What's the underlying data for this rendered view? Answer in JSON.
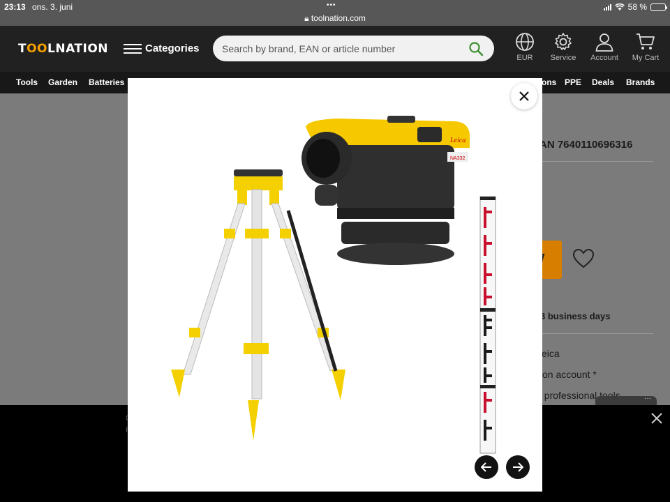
{
  "status": {
    "time": "23:13",
    "date": "ons. 3. juni",
    "url": "toolnation.com",
    "battery": "58 %",
    "battery_level": 0.58
  },
  "header": {
    "logo_pre": "T",
    "logo_o": "OO",
    "logo_post": "LNATION",
    "categories_label": "Categories",
    "search_placeholder": "Search by brand, EAN or article number",
    "currency_label": "EUR",
    "service_label": "Service",
    "account_label": "Account",
    "cart_label": "My Cart"
  },
  "nav": {
    "items": [
      "Tools",
      "Garden",
      "Batteries"
    ],
    "right_items": [
      "ons",
      "PPE",
      "Deals",
      "Brands"
    ]
  },
  "page": {
    "ean": "AN 7640110696316",
    "delivery": "3 business days",
    "brand_fragment": "eica",
    "account_fragment": "on account *",
    "pro_fragment": "f professional tools"
  },
  "banner": {
    "line1": "C",
    "line2": "F"
  },
  "modal": {
    "image_label": "Leica",
    "model_label": "NA332"
  },
  "colors": {
    "accent": "#f5a000",
    "cart": "#d77e00",
    "yellow": "#f5d000"
  }
}
